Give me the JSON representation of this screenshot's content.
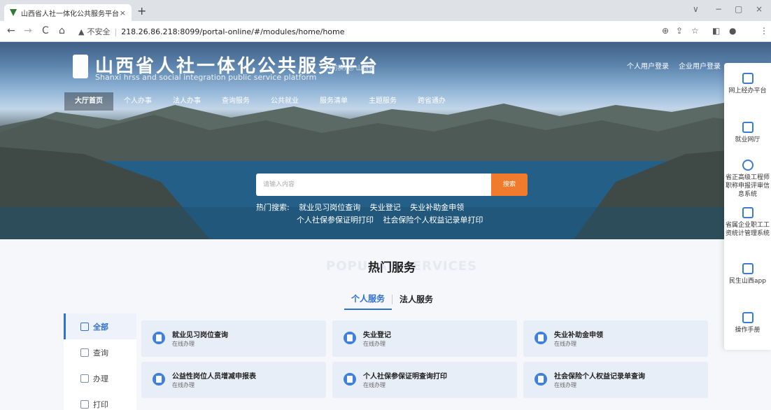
{
  "browser": {
    "tab_title": "山西省人社一体化公共服务平台",
    "tab_close": "×",
    "new_tab": "+",
    "nav": {
      "back": "←",
      "forward": "→",
      "reload": "C",
      "home": "⌂"
    },
    "security_icon": "▲",
    "security_label": "不安全",
    "separator": "|",
    "url": "218.26.86.218:8099/portal-online/#/modules/home/home",
    "right_icons": [
      "⊕",
      "⇪",
      "☆",
      "◧",
      "●",
      "⋮"
    ],
    "window_controls": [
      "∨",
      "−",
      "▢",
      "×"
    ]
  },
  "header": {
    "title": "山西省人社一体化公共服务平台",
    "subtitle": "Shanxi hrss and social integration public service platform",
    "region": "(切换) ◎ 山西省",
    "login_person": "个人用户登录",
    "login_company": "企业用户登录"
  },
  "nav": {
    "items": [
      "大厅首页",
      "个人办事",
      "法人办事",
      "查询服务",
      "公共就业",
      "服务清单",
      "主题服务",
      "跨省通办"
    ]
  },
  "search": {
    "placeholder": "请输入内容",
    "button": "搜索",
    "hot_label": "热门搜索:",
    "hot_row1": [
      "就业见习岗位查询",
      "失业登记",
      "失业补助金申领"
    ],
    "hot_row2": [
      "个人社保参保证明打印",
      "社会保险个人权益记录单打印"
    ]
  },
  "right_panel": {
    "items": [
      "网上经办平台",
      "就业网厅",
      "省正高级工程师职称申报评审信息系统",
      "省属企业职工工资统计管理系统",
      "民生山西app",
      "操作手册"
    ]
  },
  "hot_services": {
    "ghost": "POPULAR SERVICES",
    "title": "热门服务",
    "tabs": [
      "个人服务",
      "法人服务"
    ],
    "categories": [
      "全部",
      "查询",
      "办理",
      "打印"
    ],
    "cards": [
      {
        "name": "就业见习岗位查询",
        "action": "在线办理"
      },
      {
        "name": "失业登记",
        "action": "在线办理"
      },
      {
        "name": "失业补助金申领",
        "action": "在线办理"
      },
      {
        "name": "公益性岗位人员增减申报表",
        "action": "在线办理"
      },
      {
        "name": "个人社保参保证明查询打印",
        "action": "在线办理"
      },
      {
        "name": "社会保险个人权益记录单查询",
        "action": "在线办理"
      }
    ]
  },
  "colors": {
    "accent": "#2f6fd8",
    "search_button": "#f07b2c",
    "card_bg": "#e8eef7"
  }
}
